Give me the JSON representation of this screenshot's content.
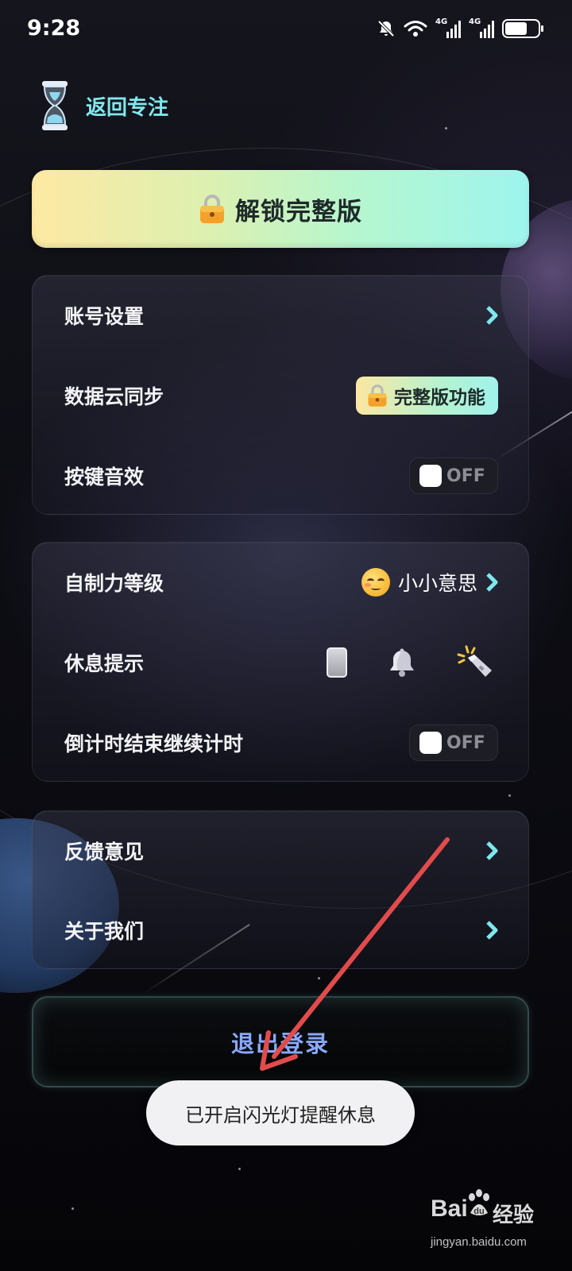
{
  "status_bar": {
    "time": "9:28",
    "signal1_label": "4G",
    "signal2_label": "4G",
    "battery_level": 0.68,
    "icons": [
      "mute-bell-icon",
      "wifi-icon",
      "signal-icon",
      "signal-icon",
      "battery-icon"
    ]
  },
  "header": {
    "back_label": "返回专注",
    "icon": "hourglass-icon"
  },
  "unlock_button": {
    "label": "解锁完整版",
    "icon": "lock-icon",
    "gradient": [
      "#fde9a3",
      "#9df5ee"
    ]
  },
  "settings_group_1": {
    "account": {
      "label": "账号设置"
    },
    "cloud_sync": {
      "label": "数据云同步",
      "badge": "完整版功能"
    },
    "key_sound": {
      "label": "按键音效",
      "toggle": "OFF"
    }
  },
  "settings_group_2": {
    "discipline_level": {
      "label": "自制力等级",
      "value": "小小意思",
      "icon": "relieved-face-emoji"
    },
    "rest_reminder": {
      "label": "休息提示",
      "options": [
        "phone-vibrate-icon",
        "bell-icon",
        "flashlight-icon"
      ]
    },
    "countdown_continue": {
      "label": "倒计时结束继续计时",
      "toggle": "OFF"
    }
  },
  "settings_group_3": {
    "feedback": {
      "label": "反馈意见"
    },
    "about": {
      "label": "关于我们"
    }
  },
  "logout_button": {
    "label": "退出登录"
  },
  "toast": {
    "text": "已开启闪光灯提醒休息"
  },
  "watermark": {
    "brand": "Bai",
    "cn": "经验",
    "url": "jingyan.baidu.com"
  },
  "colors": {
    "accent_cyan": "#7fe7ee",
    "logout_text": "#8aa8ff",
    "annotation_arrow": "#e24b4b"
  }
}
